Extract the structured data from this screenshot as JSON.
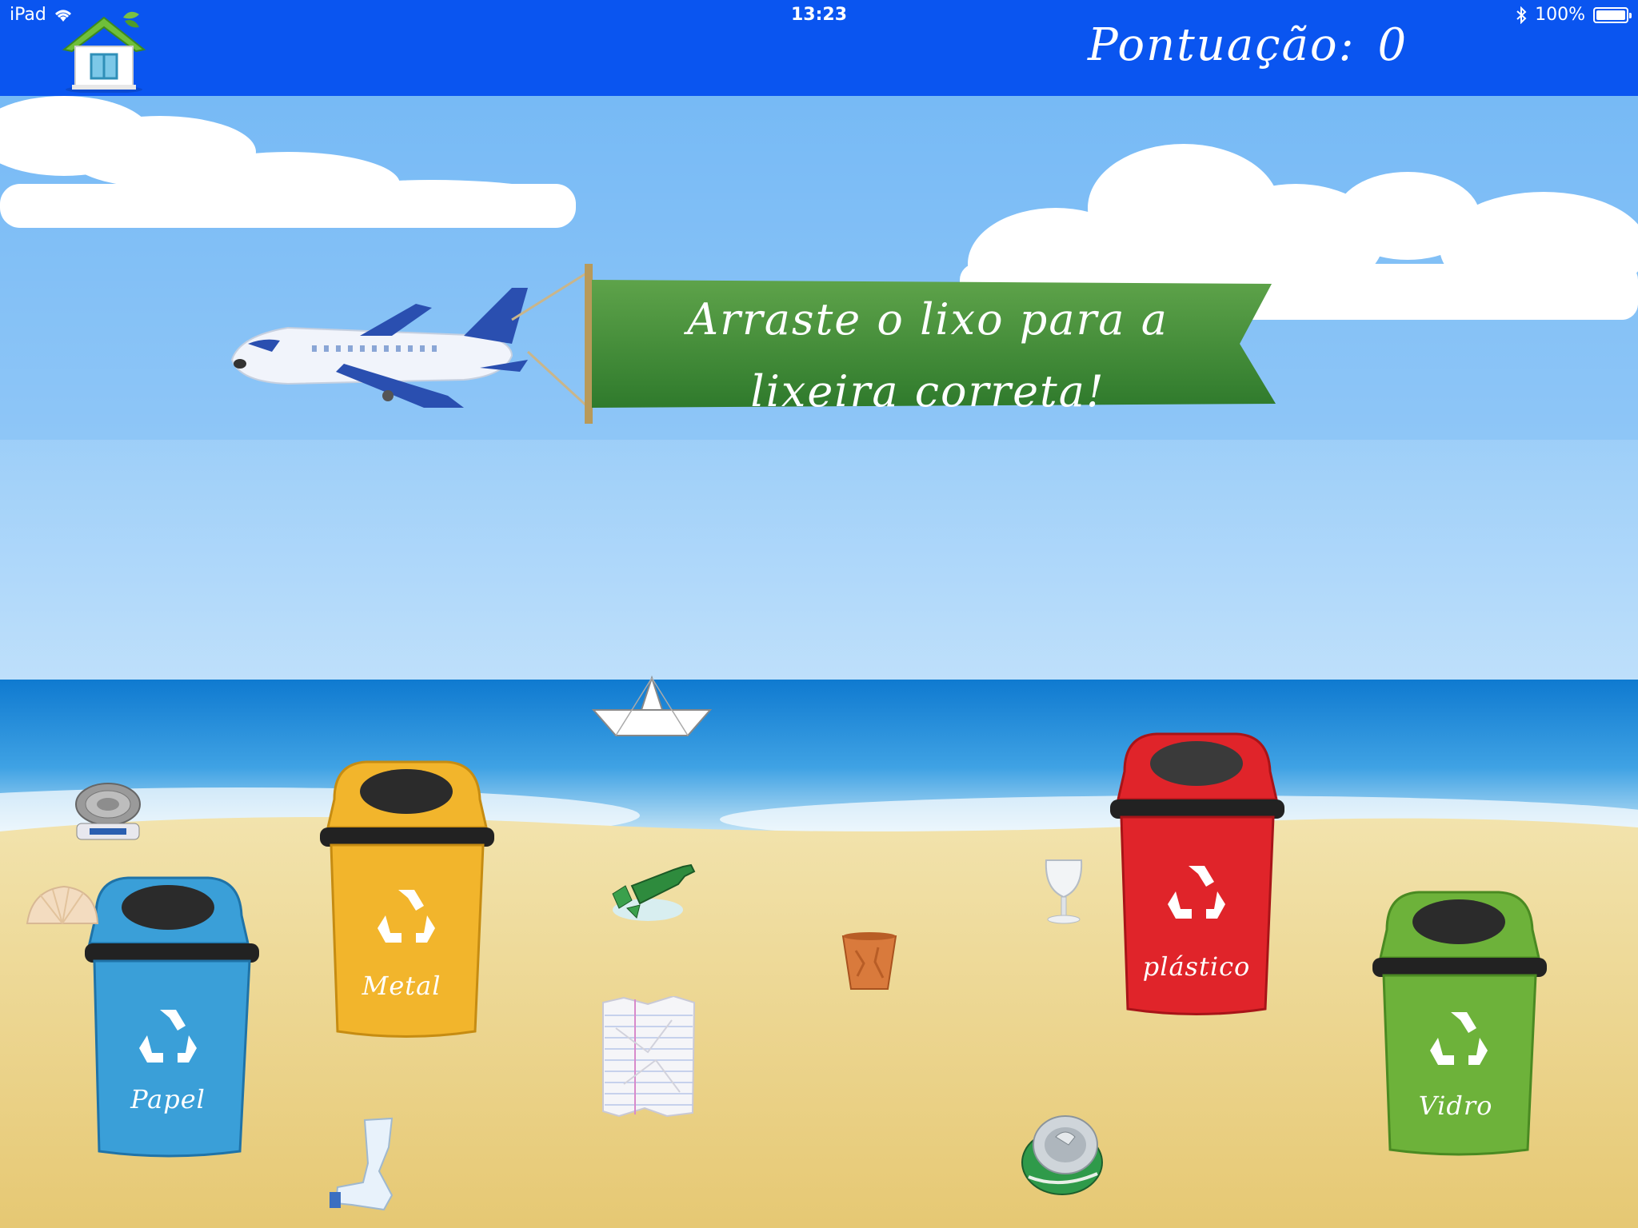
{
  "status_bar": {
    "device": "iPad",
    "time": "13:23",
    "battery": "100%"
  },
  "header": {
    "home_icon": "house-icon",
    "score_label": "Pontuação:",
    "score_value": "0"
  },
  "banner": {
    "line1": "Arraste o lixo para a",
    "line2": "lixeira correta!"
  },
  "bins": [
    {
      "label": "Papel",
      "color": "#3a9fd8"
    },
    {
      "label": "Metal",
      "color": "#f2b52c"
    },
    {
      "label": "plástico",
      "color": "#e0242a"
    },
    {
      "label": "Vidro",
      "color": "#6db23a"
    }
  ],
  "items": [
    "tuna-can",
    "shell",
    "broken-bottle",
    "paper-boat",
    "plastic-cup",
    "crumpled-paper",
    "wine-glass",
    "plastic-bottle",
    "soda-can"
  ]
}
